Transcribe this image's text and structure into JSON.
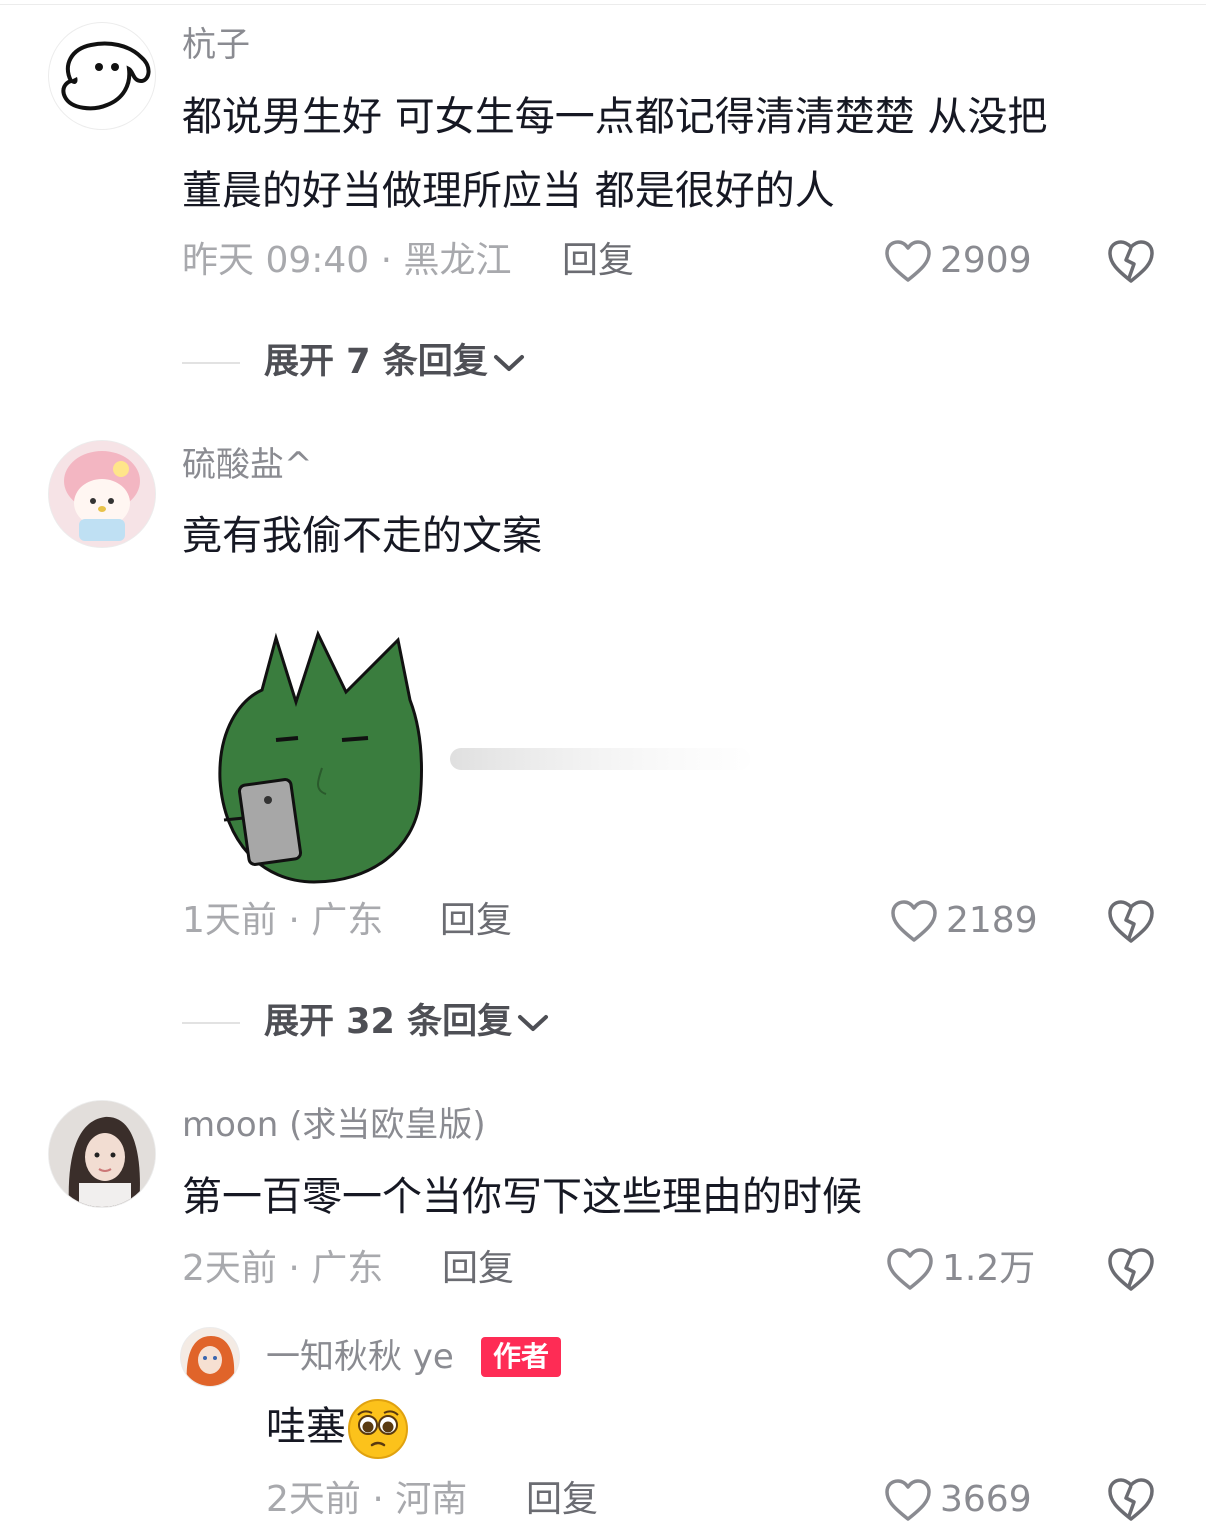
{
  "comments": [
    {
      "username": "杭子",
      "text_lines": [
        "都说男生好 可女生每一点都记得清清楚楚 从没把",
        "董晨的好当做理所应当 都是很好的人"
      ],
      "meta": "昨天 09:40 · 黑龙江",
      "reply_label": "回复",
      "likes": "2909",
      "expand_label": "展开 7 条回复"
    },
    {
      "username": "硫酸盐^",
      "text_lines": [
        "竟有我偷不走的文案"
      ],
      "meta": "1天前 · 广东",
      "reply_label": "回复",
      "likes": "2189",
      "expand_label": "展开 32 条回复",
      "sticker": "green-tulip-phone-sticker"
    },
    {
      "username": "moon (求当欧皇版)",
      "text_lines": [
        "第一百零一个当你写下这些理由的时候"
      ],
      "meta": "2天前 · 广东",
      "reply_label": "回复",
      "likes": "1.2万",
      "reply": {
        "username": "一知秋秋 ye",
        "badge": "作者",
        "text": "哇塞",
        "emoji": "pleading-face-emoji",
        "meta": "2天前 · 河南",
        "reply_label": "回复",
        "likes": "3669"
      }
    }
  ],
  "colors": {
    "accent": "#fe2c55",
    "sticker_green": "#3a7d3e",
    "meta": "#a8a9ad"
  },
  "icons": [
    "heart-icon",
    "dislike-icon",
    "chevron-down-icon"
  ]
}
